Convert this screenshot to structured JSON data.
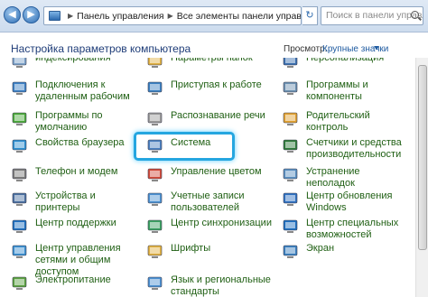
{
  "address_bar": {
    "crumbs": [
      "Панель управления",
      "Все элементы панели управления"
    ],
    "search_placeholder": "Поиск в панели управления"
  },
  "header": {
    "title": "Настройка параметров компьютера",
    "view_label": "Просмотр:",
    "view_value": "Крупные значки"
  },
  "columns": [
    [
      {
        "label": "индексирования",
        "icon": "indexing-icon",
        "color": "#7aa0c8"
      },
      {
        "label": "Подключения к удаленным рабочим",
        "icon": "remote-desktop-icon",
        "color": "#3b7fc4"
      },
      {
        "label": "Программы по умолчанию",
        "icon": "default-programs-icon",
        "color": "#4aa83a"
      },
      {
        "label": "Свойства браузера",
        "icon": "internet-options-icon",
        "color": "#2e8fd0"
      },
      {
        "label": "Телефон и модем",
        "icon": "phone-modem-icon",
        "color": "#7b7b7b"
      },
      {
        "label": "Устройства и принтеры",
        "icon": "devices-printers-icon",
        "color": "#4a6fa0"
      },
      {
        "label": "Центр поддержки",
        "icon": "action-center-flag-icon",
        "color": "#1e6fc0"
      },
      {
        "label": "Центр управления сетями и общим доступом",
        "icon": "network-center-icon",
        "color": "#3a8fd0"
      },
      {
        "label": "Электропитание",
        "icon": "power-options-icon",
        "color": "#5aa040"
      }
    ],
    [
      {
        "label": "Параметры папок",
        "icon": "folder-options-icon",
        "color": "#e0b040"
      },
      {
        "label": "Приступая к работе",
        "icon": "getting-started-icon",
        "color": "#3a7fc0"
      },
      {
        "label": "Распознавание речи",
        "icon": "microphone-icon",
        "color": "#9a9a9a"
      },
      {
        "label": "Система",
        "icon": "system-icon",
        "color": "#4a7fbf"
      },
      {
        "label": "Управление цветом",
        "icon": "color-management-icon",
        "color": "#d04a3a"
      },
      {
        "label": "Учетные записи пользователей",
        "icon": "user-accounts-icon",
        "color": "#4a90d0"
      },
      {
        "label": "Центр синхронизации",
        "icon": "sync-center-icon",
        "color": "#3aa060"
      },
      {
        "label": "Шрифты",
        "icon": "fonts-icon",
        "color": "#e0b040"
      },
      {
        "label": "Язык и региональные стандарты",
        "icon": "region-language-icon",
        "color": "#4a8fd0"
      }
    ],
    [
      {
        "label": "Персонализация",
        "icon": "personalization-icon",
        "color": "#3a6fb0"
      },
      {
        "label": "Программы и компоненты",
        "icon": "programs-features-icon",
        "color": "#6a8fb0"
      },
      {
        "label": "Родительский контроль",
        "icon": "parental-controls-icon",
        "color": "#e0a030"
      },
      {
        "label": "Счетчики и средства производительности",
        "icon": "performance-icon",
        "color": "#2e7a3a"
      },
      {
        "label": "Устранение неполадок",
        "icon": "troubleshooting-icon",
        "color": "#5a8fc0"
      },
      {
        "label": "Центр обновления Windows",
        "icon": "windows-update-icon",
        "color": "#2e70c0"
      },
      {
        "label": "Центр специальных возможностей",
        "icon": "ease-of-access-icon",
        "color": "#1e6fc0"
      },
      {
        "label": "Экран",
        "icon": "display-icon",
        "color": "#3a7fbf"
      },
      {
        "label": "",
        "icon": "",
        "color": ""
      }
    ]
  ]
}
